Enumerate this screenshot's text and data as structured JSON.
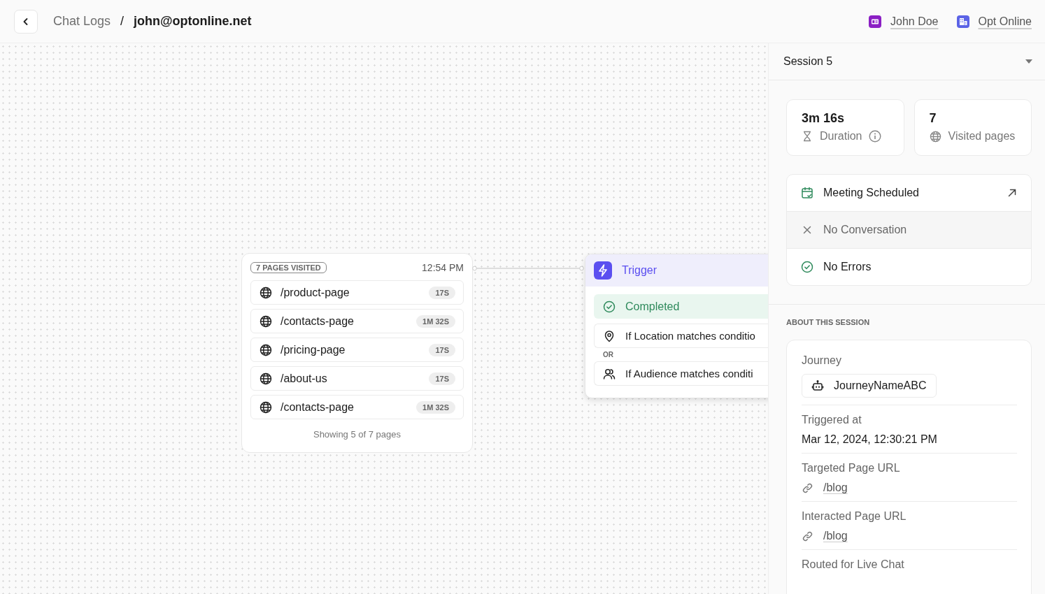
{
  "breadcrumb": {
    "parent": "Chat Logs",
    "separator": "/",
    "current": "john@optonline.net"
  },
  "header_links": [
    {
      "kind": "contact",
      "label": "John Doe"
    },
    {
      "kind": "company",
      "label": "Opt Online"
    }
  ],
  "pages_card": {
    "badge": "7 PAGES VISITED",
    "time": "12:54 PM",
    "footer": "Showing 5 of 7 pages",
    "pages": [
      {
        "path": "/product-page",
        "duration": "17S"
      },
      {
        "path": "/contacts-page",
        "duration": "1M 32S"
      },
      {
        "path": "/pricing-page",
        "duration": "17S"
      },
      {
        "path": "/about-us",
        "duration": "17S"
      },
      {
        "path": "/contacts-page",
        "duration": "1M 32S"
      }
    ]
  },
  "trigger": {
    "title": "Trigger",
    "conditions": [
      {
        "kind": "status",
        "text": "Completed"
      },
      {
        "kind": "location",
        "text": "If Location matches conditio"
      },
      {
        "kind": "separator",
        "text": "OR"
      },
      {
        "kind": "audience",
        "text": "If Audience matches conditi"
      }
    ]
  },
  "session": {
    "selector": "Session 5",
    "stats": [
      {
        "kind": "duration",
        "value": "3m 16s",
        "label": "Duration"
      },
      {
        "kind": "pages",
        "value": "7",
        "label": "Visited pages"
      }
    ],
    "outcomes": [
      {
        "kind": "meeting",
        "text": "Meeting Scheduled"
      },
      {
        "kind": "none",
        "text": "No Conversation"
      },
      {
        "kind": "ok",
        "text": "No Errors"
      }
    ],
    "about_heading": "ABOUT THIS SESSION",
    "fields": [
      {
        "kind": "chip",
        "label": "Journey",
        "value": "JourneyNameABC"
      },
      {
        "kind": "text",
        "label": "Triggered at",
        "value": "Mar 12, 2024, 12:30:21 PM"
      },
      {
        "kind": "link",
        "label": "Targeted Page URL",
        "value": "/blog"
      },
      {
        "kind": "link",
        "label": "Interacted Page URL",
        "value": "/blog"
      },
      {
        "kind": "label",
        "label": "Routed for Live Chat"
      }
    ]
  }
}
